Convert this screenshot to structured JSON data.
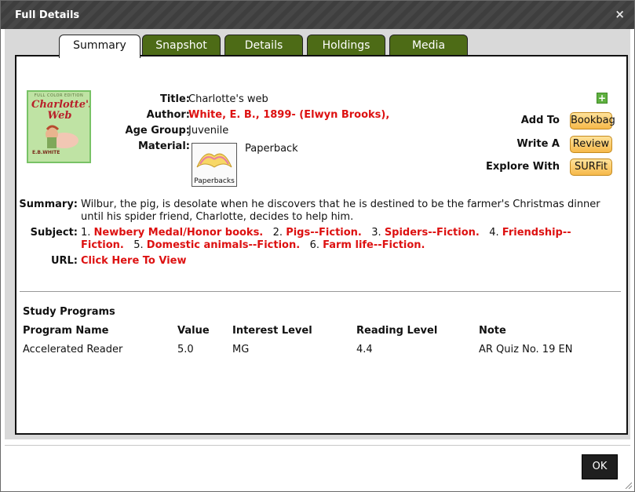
{
  "dialog": {
    "title": "Full Details",
    "close_glyph": "×"
  },
  "tabs": [
    {
      "label": "Summary",
      "active": true
    },
    {
      "label": "Snapshot",
      "active": false
    },
    {
      "label": "Details",
      "active": false
    },
    {
      "label": "Holdings",
      "active": false
    },
    {
      "label": "Media",
      "active": false
    }
  ],
  "cover": {
    "top_text": "FULL COLOR EDITION",
    "title": "Charlotte's Web",
    "author": "E.B.WHITE"
  },
  "record": {
    "title_label": "Title:",
    "title": "Charlotte's web",
    "author_label": "Author:",
    "author": "White, E. B., 1899- (Elwyn Brooks),",
    "age_label": "Age Group:",
    "age": "Juvenile",
    "material_label": "Material:",
    "material": "Paperback",
    "material_icon_label": "Paperbacks",
    "summary_label": "Summary:",
    "summary": "Wilbur, the pig, is desolate when he discovers that he is destined to be the farmer's Christmas dinner until his spider friend, Charlotte, decides to help him.",
    "subject_label": "Subject:",
    "subjects": [
      {
        "num": "1.",
        "text": "Newbery Medal/Honor books."
      },
      {
        "num": "2.",
        "text": "Pigs--Fiction."
      },
      {
        "num": "3.",
        "text": "Spiders--Fiction."
      },
      {
        "num": "4.",
        "text": "Friendship--Fiction."
      },
      {
        "num": "5.",
        "text": "Domestic animals--Fiction."
      },
      {
        "num": "6.",
        "text": "Farm life--Fiction."
      }
    ],
    "url_label": "URL:",
    "url_link": "Click Here To View"
  },
  "actions": {
    "plus": "+",
    "add_to_label": "Add To",
    "add_to_button": "Bookbag",
    "write_label": "Write A",
    "write_button": "Review",
    "explore_label": "Explore With",
    "explore_button": "SURFit"
  },
  "study_programs": {
    "title": "Study Programs",
    "headers": [
      "Program Name",
      "Value",
      "Interest Level",
      "Reading Level",
      "Note"
    ],
    "rows": [
      [
        "Accelerated Reader",
        "5.0",
        "MG",
        "4.4",
        "AR Quiz No. 19 EN"
      ]
    ]
  },
  "footer": {
    "ok_label": "OK"
  },
  "colors": {
    "tab_green": "#4d6b16",
    "link_red": "#dd1111",
    "button_orange": "#f6b94a"
  }
}
